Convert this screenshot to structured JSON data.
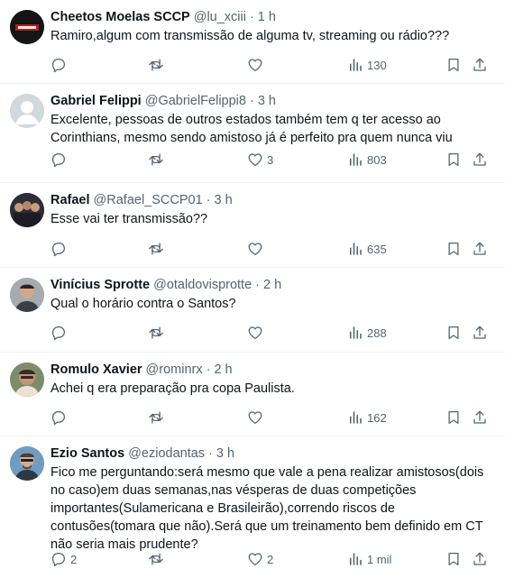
{
  "tweets": [
    {
      "name": "Cheetos Moelas SCCP",
      "handle": "@lu_xciii",
      "time": "1 h",
      "text": "Ramiro,algum com transmissão de alguma tv, streaming ou rádio???",
      "replies": "",
      "retweets": "",
      "likes": "",
      "views": "130",
      "avatar_color": "#1a1a1a"
    },
    {
      "name": "Gabriel Felippi",
      "handle": "@GabrielFelippi8",
      "time": "3 h",
      "text": "Excelente, pessoas de outros estados também tem q ter acesso ao Corinthians, mesmo sendo amistoso já é perfeito pra quem nunca viu",
      "replies": "",
      "retweets": "",
      "likes": "3",
      "views": "803",
      "avatar_color": "#cfd9de"
    },
    {
      "name": "Rafael",
      "handle": "@Rafael_SCCP01",
      "time": "3 h",
      "text": "Esse vai ter transmissão??",
      "replies": "",
      "retweets": "",
      "likes": "",
      "views": "635",
      "avatar_color": "#3b3a46"
    },
    {
      "name": "Vinícius Sprotte",
      "handle": "@otaldovisprotte",
      "time": "2 h",
      "text": "Qual o horário contra o Santos?",
      "replies": "",
      "retweets": "",
      "likes": "",
      "views": "288",
      "avatar_color": "#8a8f94"
    },
    {
      "name": "Romulo Xavier",
      "handle": "@rominrx",
      "time": "2 h",
      "text": "Achei q era preparação pra copa Paulista.",
      "replies": "",
      "retweets": "",
      "likes": "",
      "views": "162",
      "avatar_color": "#b98a6a"
    },
    {
      "name": "Ezio Santos",
      "handle": "@eziodantas",
      "time": "3 h",
      "text": "Fico me perguntando:será mesmo que vale a pena realizar amistosos(dois no caso)em duas semanas,nas vésperas de duas competições importantes(Sulamericana e Brasileirão),correndo riscos de contusões(tomara que não).Será que um treinamento bem definido em CT não seria mais prudente?",
      "replies": "2",
      "retweets": "",
      "likes": "2",
      "views": "1 mil",
      "avatar_color": "#5b82a8"
    }
  ]
}
